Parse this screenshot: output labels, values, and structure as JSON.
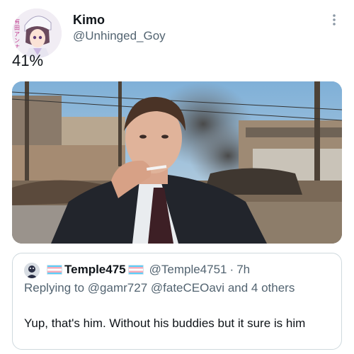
{
  "tweet": {
    "author_name": "Kimo",
    "author_handle": "@Unhinged_Goy",
    "avatar_text": "有田アンナ",
    "text": "41%",
    "more_icon": "more-vertical-icon"
  },
  "media": {
    "description_icon": "photo"
  },
  "quote": {
    "author_name": "Temple475",
    "author_handle": "@Temple4751",
    "separator": "·",
    "time": "7h",
    "reply_prefix": "Replying to",
    "mention_1": "@gamr727",
    "mention_2": "@fateCEOavi",
    "reply_suffix": "and 4 others",
    "text": "Yup, that's him. Without his buddies but it sure is him"
  },
  "colors": {
    "secondary_text": "#536471",
    "border": "#cfd9de",
    "flag_blue": "#5bcffa",
    "flag_pink": "#f5abb9"
  }
}
